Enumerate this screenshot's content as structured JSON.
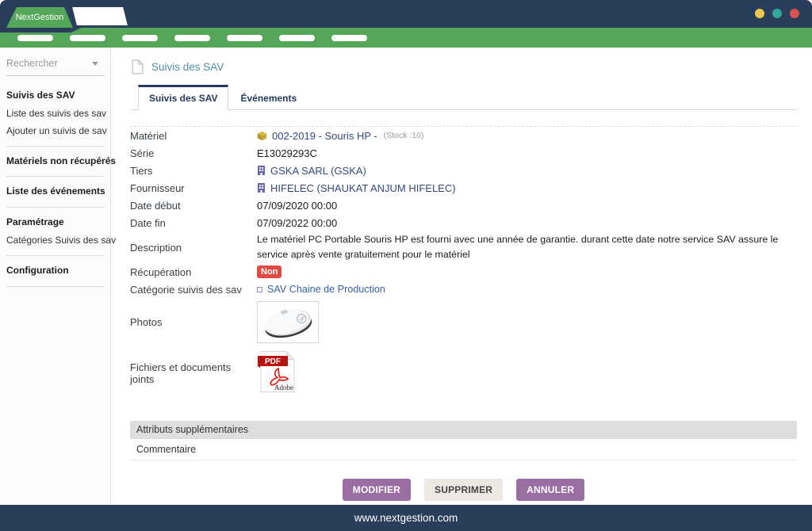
{
  "window": {
    "brand": "NextGestion",
    "footer_url": "www.nextgestion.com"
  },
  "colors": {
    "navy": "#2a3e5c",
    "accent_green": "#54a758",
    "title_teal": "#4f8fa6",
    "link_navy": "#364a7e",
    "link_blue": "#3b5fa8",
    "badge_red": "#e04a42",
    "button_purple": "#9a6da3"
  },
  "sidebar": {
    "search_placeholder": "Rechercher",
    "items": [
      {
        "label": "Suivis des SAV",
        "bold": true
      },
      {
        "label": "Liste des suivis des sav",
        "bold": false
      },
      {
        "label": "Ajouter un suivis de sav",
        "bold": false
      },
      {
        "label": "Matériels non récupérés",
        "bold": true
      },
      {
        "label": "Liste des événements",
        "bold": true
      },
      {
        "label": "Paramétrage",
        "bold": true
      },
      {
        "label": "Catégories Suivis des sav",
        "bold": false
      },
      {
        "label": "Configuration",
        "bold": true
      }
    ]
  },
  "page": {
    "title": "Suivis des SAV",
    "tabs": [
      {
        "label": "Suivis des SAV",
        "active": true
      },
      {
        "label": "Événements",
        "active": false
      }
    ]
  },
  "details": {
    "materiel": {
      "label": "Matériel",
      "value": "002-2019 - Souris HP -",
      "stock": "(Stock :10)"
    },
    "serie": {
      "label": "Série",
      "value": "E13029293C"
    },
    "tiers": {
      "label": "Tiers",
      "value": "GSKA SARL (GSKA)"
    },
    "fournisseur": {
      "label": "Fournisseur",
      "value": "HIFELEC (SHAUKAT ANJUM HIFELEC)"
    },
    "date_debut": {
      "label": "Date début",
      "value": "07/09/2020 00:00"
    },
    "date_fin": {
      "label": "Date fin",
      "value": "07/09/2022 00:00"
    },
    "description": {
      "label": "Description",
      "value": "Le matériel PC Portable Souris HP est fourni avec une année de garantie. durant cette date notre service SAV assure le service après vente gratuitement pour le matériel"
    },
    "recuperation": {
      "label": "Récupération",
      "badge": "Non"
    },
    "categorie": {
      "label": "Catégorie suivis des sav",
      "value": "SAV Chaine de Production"
    },
    "photos": {
      "label": "Photos"
    },
    "fichiers": {
      "label": "Fichiers et documents joints",
      "pdf_text": "PDF",
      "pdf_brand": "Adobe"
    }
  },
  "extra_attributes": {
    "header": "Attributs supplémentaires",
    "comment_label": "Commentaire"
  },
  "actions": {
    "modify": "MODIFIER",
    "delete": "SUPPRIMER",
    "cancel": "ANNULER"
  }
}
